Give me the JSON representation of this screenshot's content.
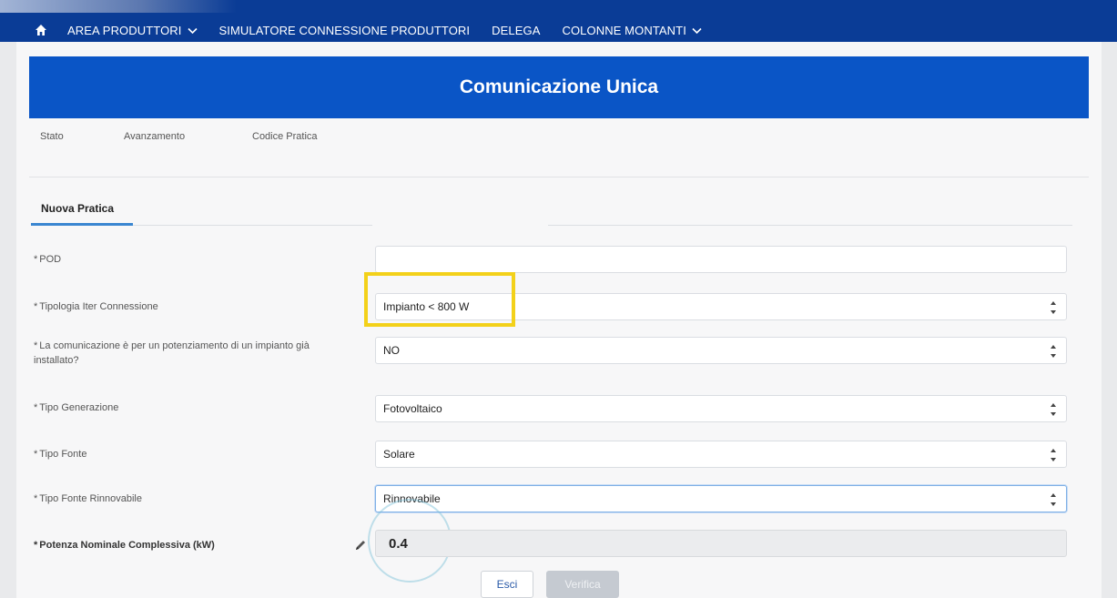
{
  "nav": {
    "home_icon": "home-icon",
    "items": [
      {
        "label": "AREA PRODUTTORI",
        "has_dropdown": true
      },
      {
        "label": "SIMULATORE CONNESSIONE PRODUTTORI",
        "has_dropdown": false
      },
      {
        "label": "DELEGA",
        "has_dropdown": false
      },
      {
        "label": "COLONNE MONTANTI",
        "has_dropdown": true
      }
    ]
  },
  "page": {
    "title": "Comunicazione Unica"
  },
  "info": {
    "stato": "Stato",
    "avanzamento": "Avanzamento",
    "codice_pratica": "Codice Pratica"
  },
  "tab": {
    "label": "Nuova Pratica"
  },
  "form": {
    "pod": {
      "label": "POD",
      "value": ""
    },
    "tipologia": {
      "label": "Tipologia Iter Connessione",
      "value": "Impianto < 800 W"
    },
    "potenziamento": {
      "label": "La comunicazione è per un potenziamento di un impianto già installato?",
      "value": "NO"
    },
    "tipo_generazione": {
      "label": "Tipo Generazione",
      "value": "Fotovoltaico"
    },
    "tipo_fonte": {
      "label": "Tipo Fonte",
      "value": "Solare"
    },
    "tipo_fonte_rinnovabile": {
      "label": "Tipo Fonte Rinnovabile",
      "value": "Rinnovabile"
    },
    "potenza": {
      "label": "Potenza Nominale Complessiva (kW)",
      "value": "0.4"
    },
    "required_mark": "*"
  },
  "buttons": {
    "esci": "Esci",
    "verifica": "Verifica"
  },
  "colors": {
    "nav_bg": "#0a3c96",
    "banner_bg": "#0a55c6",
    "highlight": "#f3d11a",
    "tab_accent": "#3a86d1"
  }
}
